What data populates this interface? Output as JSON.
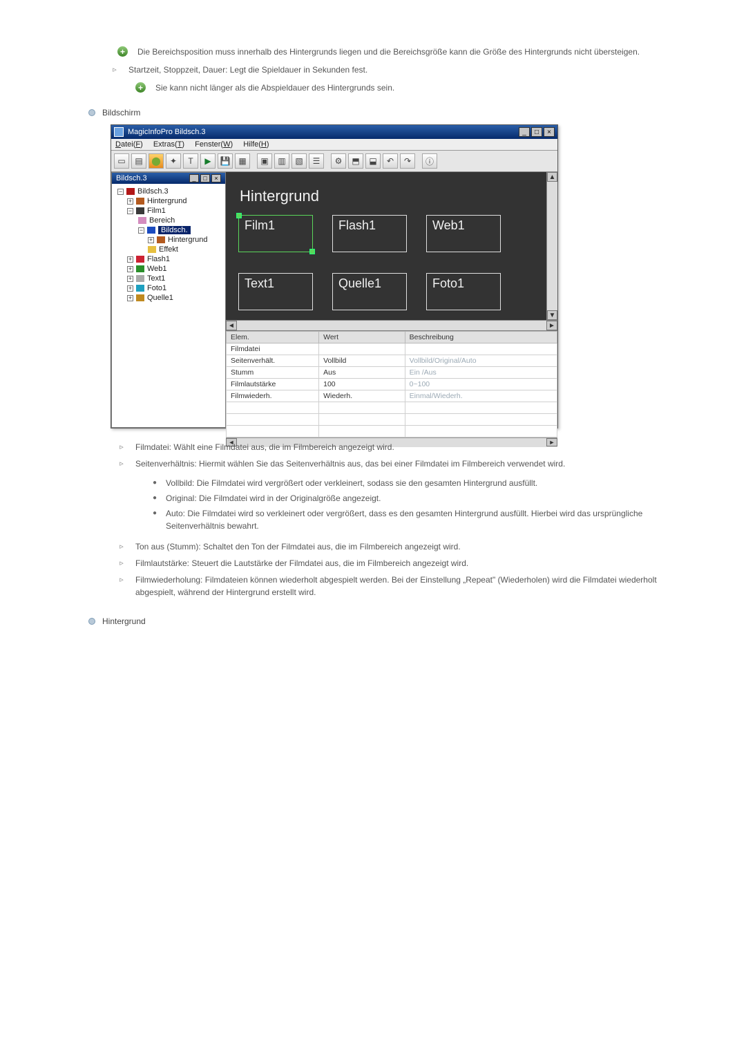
{
  "notes": {
    "n1": "Die Bereichsposition muss innerhalb des Hintergrunds liegen und die Bereichsgröße kann die Größe des Hintergrunds nicht übersteigen.",
    "n2": "Startzeit, Stoppzeit, Dauer: Legt die Spieldauer in Sekunden fest.",
    "n2a": "Sie kann nicht länger als die Abspieldauer des Hintergrunds sein."
  },
  "section_bildschirm": "Bildschirm",
  "app": {
    "title": "MagicInfoPro Bildsch.3",
    "menu": {
      "datei": "Datei(F)",
      "extras": "Extras(T)",
      "fenster": "Fenster(W)",
      "hilfe": "Hilfe(H)"
    },
    "tree_title": "Bildsch.3",
    "tree": {
      "root": "Bildsch.3",
      "hint": "Hintergrund",
      "film": "Film1",
      "bereich": "Bereich",
      "bildsch": "Bildsch.",
      "hint2": "Hintergrund",
      "effekt": "Effekt",
      "flash": "Flash1",
      "web": "Web1",
      "text": "Text1",
      "foto": "Foto1",
      "quelle": "Quelle1"
    },
    "canvas": {
      "heading": "Hintergrund",
      "b1": "Film1",
      "b2": "Flash1",
      "b3": "Web1",
      "b4": "Text1",
      "b5": "Quelle1",
      "b6": "Foto1"
    },
    "props": {
      "h1": "Elem.",
      "h2": "Wert",
      "h3": "Beschreibung",
      "rows": [
        {
          "k": "Filmdatei",
          "v": "",
          "d": ""
        },
        {
          "k": "Seitenverhält.",
          "v": "Vollbild",
          "d": "Vollbild/Original/Auto"
        },
        {
          "k": "Stumm",
          "v": "Aus",
          "d": "Ein /Aus"
        },
        {
          "k": "Filmlautstärke",
          "v": "100",
          "d": "0~100"
        },
        {
          "k": "Filmwiederh.",
          "v": "Wiederh.",
          "d": "Einmal/Wiederh."
        }
      ]
    }
  },
  "doc": {
    "filmdatei": "Filmdatei: Wählt eine Filmdatei aus, die im Filmbereich angezeigt wird.",
    "seiten": "Seitenverhältnis: Hiermit wählen Sie das Seitenverhältnis aus, das bei einer Filmdatei im Filmbereich verwendet wird.",
    "vollbild": "Vollbild: Die Filmdatei wird vergrößert oder verkleinert, sodass sie den gesamten Hintergrund ausfüllt.",
    "original": "Original: Die Filmdatei wird in der Originalgröße angezeigt.",
    "auto": "Auto: Die Filmdatei wird so verkleinert oder vergrößert, dass es den gesamten Hintergrund ausfüllt. Hierbei wird das ursprüngliche Seitenverhältnis bewahrt.",
    "ton": "Ton aus (Stumm): Schaltet den Ton der Filmdatei aus, die im Filmbereich angezeigt wird.",
    "laut": "Filmlautstärke: Steuert die Lautstärke der Filmdatei aus, die im Filmbereich angezeigt wird.",
    "wied": "Filmwiederholung: Filmdateien können wiederholt abgespielt werden. Bei der Einstellung „Repeat\" (Wiederholen) wird die Filmdatei wiederholt abgespielt, während der Hintergrund erstellt wird."
  },
  "section_hint": "Hintergrund",
  "icons": {
    "plus": "+",
    "arrow": "▹",
    "dot": "●"
  }
}
